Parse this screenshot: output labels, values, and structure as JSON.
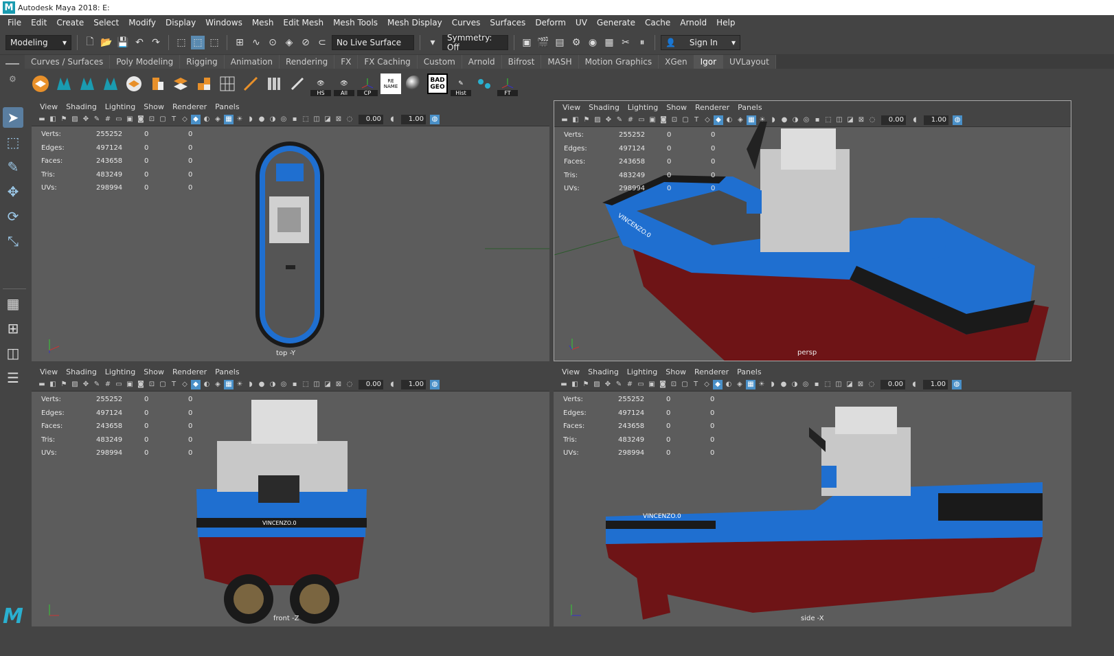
{
  "window": {
    "title": "Autodesk Maya 2018: E:",
    "logo": "M"
  },
  "menu": [
    "File",
    "Edit",
    "Create",
    "Select",
    "Modify",
    "Display",
    "Windows",
    "Mesh",
    "Edit Mesh",
    "Mesh Tools",
    "Mesh Display",
    "Curves",
    "Surfaces",
    "Deform",
    "UV",
    "Generate",
    "Cache",
    "Arnold",
    "Help"
  ],
  "status": {
    "mode": "Modeling",
    "live_surface": "No Live Surface",
    "symmetry": "Symmetry: Off",
    "sign_in": "Sign In"
  },
  "shelf_tabs": [
    "Curves / Surfaces",
    "Poly Modeling",
    "Rigging",
    "Animation",
    "Rendering",
    "FX",
    "FX Caching",
    "Custom",
    "Arnold",
    "Bifrost",
    "MASH",
    "Motion Graphics",
    "XGen",
    "Igor",
    "UVLayout"
  ],
  "active_shelf_tab": "Igor",
  "shelf_labels": {
    "hs": "HS",
    "all": "All",
    "cp": "CP",
    "rename": "RE NAME",
    "badgeo": "BAD GEO",
    "hist": "Hist",
    "ft": "FT"
  },
  "panel_menu": [
    "View",
    "Shading",
    "Lighting",
    "Show",
    "Renderer",
    "Panels"
  ],
  "panel_fields": {
    "exposure": "0.00",
    "gamma": "1.00"
  },
  "hud": [
    {
      "label": "Verts:",
      "value": "255252",
      "sel": "0",
      "uv": "0"
    },
    {
      "label": "Edges:",
      "value": "497124",
      "sel": "0",
      "uv": "0"
    },
    {
      "label": "Faces:",
      "value": "243658",
      "sel": "0",
      "uv": "0"
    },
    {
      "label": "Tris:",
      "value": "483249",
      "sel": "0",
      "uv": "0"
    },
    {
      "label": "UVs:",
      "value": "298994",
      "sel": "0",
      "uv": "0"
    }
  ],
  "viewports": {
    "top": "top -Y",
    "persp": "persp",
    "front": "front -Z",
    "side": "side -X"
  },
  "boat_name": "VINCENZO.0",
  "colors": {
    "hull_blue": "#1f6fd0",
    "hull_red": "#6e1416",
    "fender": "#1a1a1a",
    "viewport_bg": "#5c5c5c",
    "accent": "#1a9bb0"
  }
}
